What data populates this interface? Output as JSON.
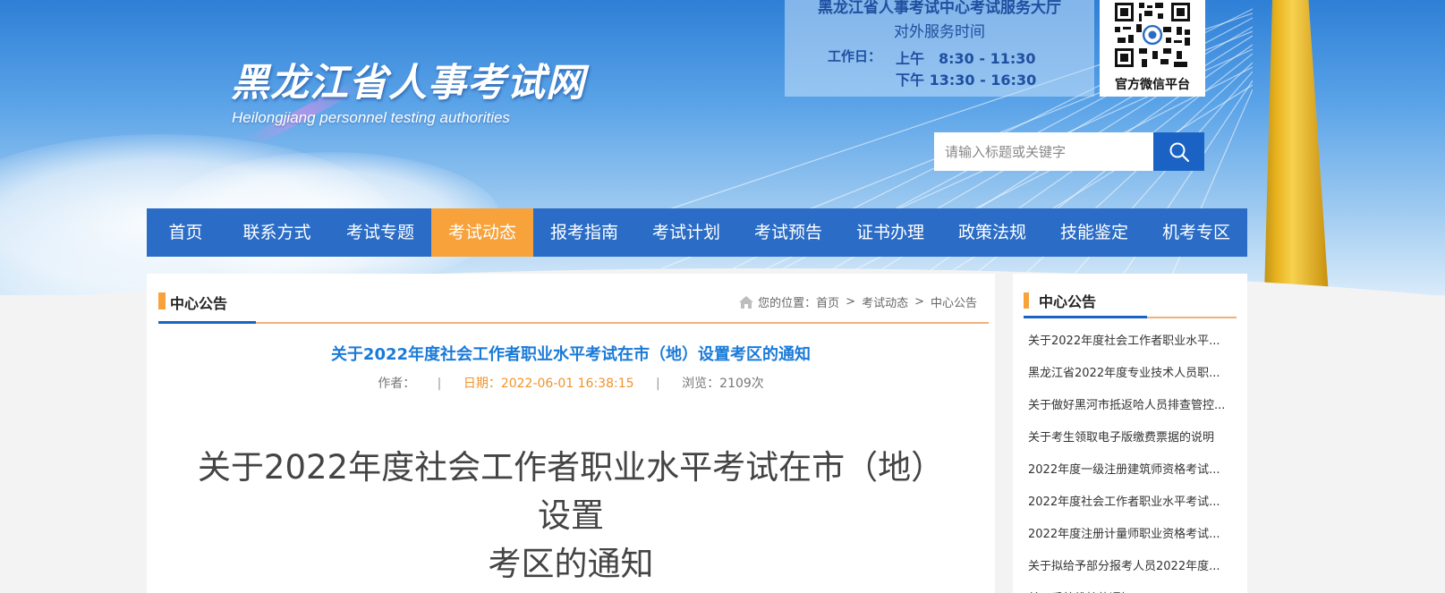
{
  "header": {
    "site_title": "黑龙江省人事考试网",
    "site_subtitle": "Heilongjiang personnel testing authorities",
    "service": {
      "title": "黑龙江省人事考试中心考试服务大厅",
      "subtitle": "对外服务时间",
      "workday_label": "工作日：",
      "morning": "上午　8:30 - 11:30",
      "afternoon": "下午 13:30 - 16:30"
    },
    "qr_label": "官方微信平台",
    "search": {
      "placeholder": "请输入标题或关键字"
    }
  },
  "nav": {
    "items": [
      {
        "label": "首页"
      },
      {
        "label": "联系方式"
      },
      {
        "label": "考试专题"
      },
      {
        "label": "考试动态"
      },
      {
        "label": "报考指南"
      },
      {
        "label": "考试计划"
      },
      {
        "label": "考试预告"
      },
      {
        "label": "证书办理"
      },
      {
        "label": "政策法规"
      },
      {
        "label": "技能鉴定"
      },
      {
        "label": "机考专区"
      }
    ],
    "active_label": "考试动态"
  },
  "main": {
    "heading": "中心公告",
    "breadcrumb": {
      "prefix": "您的位置：",
      "items": [
        "首页",
        "考试动态",
        "中心公告"
      ],
      "separator": ">"
    },
    "article": {
      "title": "关于2022年度社会工作者职业水平考试在市（地）设置考区的通知",
      "author_label": "作者：",
      "date": "日期：2022-06-01 16:38:15",
      "views": "浏览：2109次",
      "big_title_line1": "关于2022年度社会工作者职业水平考试在市（地）设置",
      "big_title_line2": "考区的通知"
    }
  },
  "sidebar": {
    "heading": "中心公告",
    "items": [
      "关于2022年度社会工作者职业水平...",
      "黑龙江省2022年度专业技术人员职...",
      "关于做好黑河市抵返哈人员排查管控...",
      "关于考生领取电子版缴费票据的说明",
      "2022年度一级注册建筑师资格考试...",
      "2022年度社会工作者职业水平考试...",
      "2022年度注册计量师职业资格考试...",
      "关于拟给予部分报考人员2022年度...",
      "关于系统维护的通知"
    ]
  },
  "colors": {
    "nav_bg": "#2a6cc6",
    "nav_active": "#f7a23b",
    "title_blue": "#1a7ad8",
    "date_orange": "#f0932b",
    "search_btn": "#1a63c4"
  },
  "icons": {
    "search": "search-icon",
    "home": "home-icon",
    "qr": "qr-code-icon"
  }
}
